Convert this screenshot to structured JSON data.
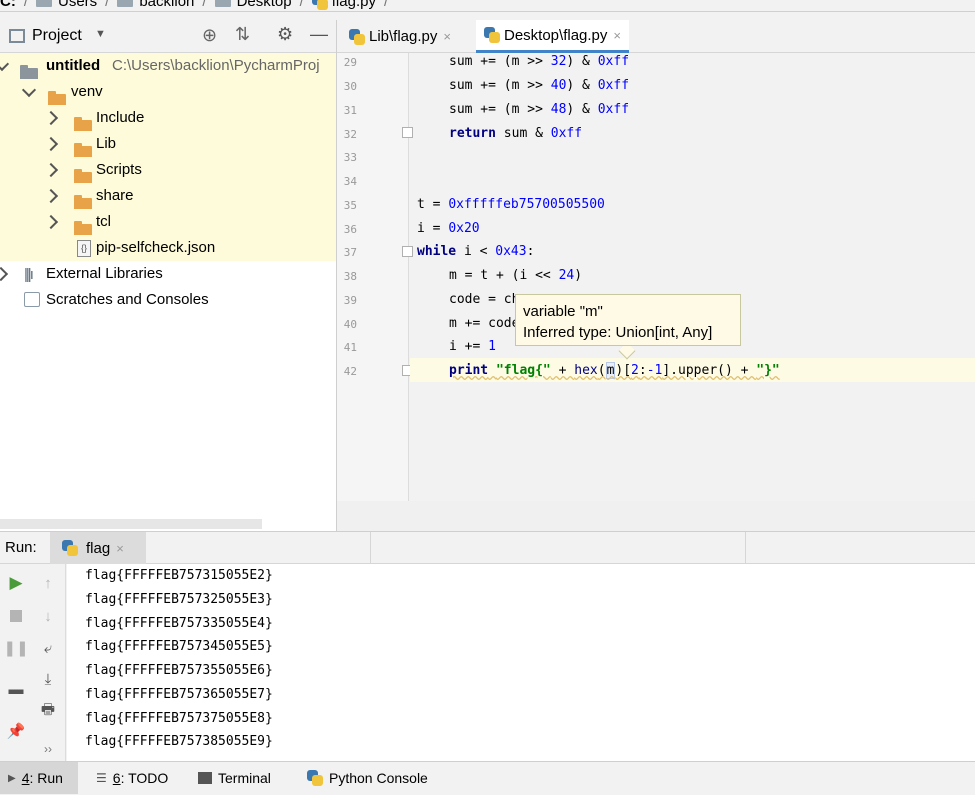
{
  "breadcrumb": [
    "C:",
    "Users",
    "backlion",
    "Desktop",
    "flag.py"
  ],
  "project": {
    "title": "Project",
    "root_name": "untitled",
    "root_path": "C:\\Users\\backlion\\PycharmProj",
    "venv": "venv",
    "folders": [
      "Include",
      "Lib",
      "Scripts",
      "share",
      "tcl"
    ],
    "file": "pip-selfcheck.json",
    "external": "External Libraries",
    "scratches": "Scratches and Consoles"
  },
  "editor": {
    "tabs": [
      {
        "label": "Lib\\flag.py",
        "close": "×"
      },
      {
        "label": "Desktop\\flag.py",
        "close": "×"
      }
    ],
    "line_numbers": [
      "29",
      "30",
      "31",
      "32",
      "33",
      "34",
      "35",
      "36",
      "37",
      "38",
      "39",
      "40",
      "41",
      "42"
    ],
    "code": {
      "l29_a": "sum += (m >> ",
      "l29_n": "32",
      "l29_b": ") & ",
      "l29_h": "0xff",
      "l30_a": "sum += (m >> ",
      "l30_n": "40",
      "l30_b": ") & ",
      "l30_h": "0xff",
      "l31_a": "sum += (m >> ",
      "l31_n": "48",
      "l31_b": ") & ",
      "l31_h": "0xff",
      "l32_kw": "return",
      "l32_a": " sum & ",
      "l32_h": "0xff",
      "l35_a": "t = ",
      "l35_h": "0xfffffeb75700505500",
      "l36_a": "i = ",
      "l36_h": "0x20",
      "l37_kw": "while",
      "l37_a": " i < ",
      "l37_h": "0x43",
      "l37_b": ":",
      "l38_a": "m = t + (i << ",
      "l38_n": "24",
      "l38_b": ")",
      "l39_a": "code = ch",
      "l40_a": "m += code",
      "l41_a": "i += ",
      "l41_n": "1",
      "l42_kw": "print",
      "l42_s1": "\"flag{\"",
      "l42_a": " + ",
      "l42_fn": "hex",
      "l42_b": "(",
      "l42_m": "m",
      "l42_c": ")[",
      "l42_n1": "2",
      "l42_d": ":",
      "l42_n2": "-1",
      "l42_e": "].upper() + ",
      "l42_s2": "\"}\""
    },
    "tooltip": {
      "line1": "variable \"m\"",
      "line2": "Inferred type: Union[int, Any]"
    }
  },
  "run": {
    "label": "Run:",
    "tab": "flag",
    "tab_close": "×",
    "output": [
      "flag{FFFFFEB757315055E2}",
      "flag{FFFFFEB757325055E3}",
      "flag{FFFFFEB757335055E4}",
      "flag{FFFFFEB757345055E5}",
      "flag{FFFFFEB757355055E6}",
      "flag{FFFFFEB757365055E7}",
      "flag{FFFFFEB757375055E8}",
      "flag{FFFFFEB757385055E9}"
    ]
  },
  "bottom_tabs": [
    {
      "num": "4",
      "label": ": Run"
    },
    {
      "num": "6",
      "label": ": TODO"
    },
    {
      "num": "",
      "label": "Terminal"
    },
    {
      "num": "",
      "label": "Python Console"
    }
  ],
  "colors": {
    "accent": "#4083c9",
    "folder": "#e8a247",
    "keyword": "#000080",
    "number": "#0000ff",
    "string": "#008000",
    "highlight_row": "#fdfbd9",
    "run_green": "#4a9c3a"
  }
}
